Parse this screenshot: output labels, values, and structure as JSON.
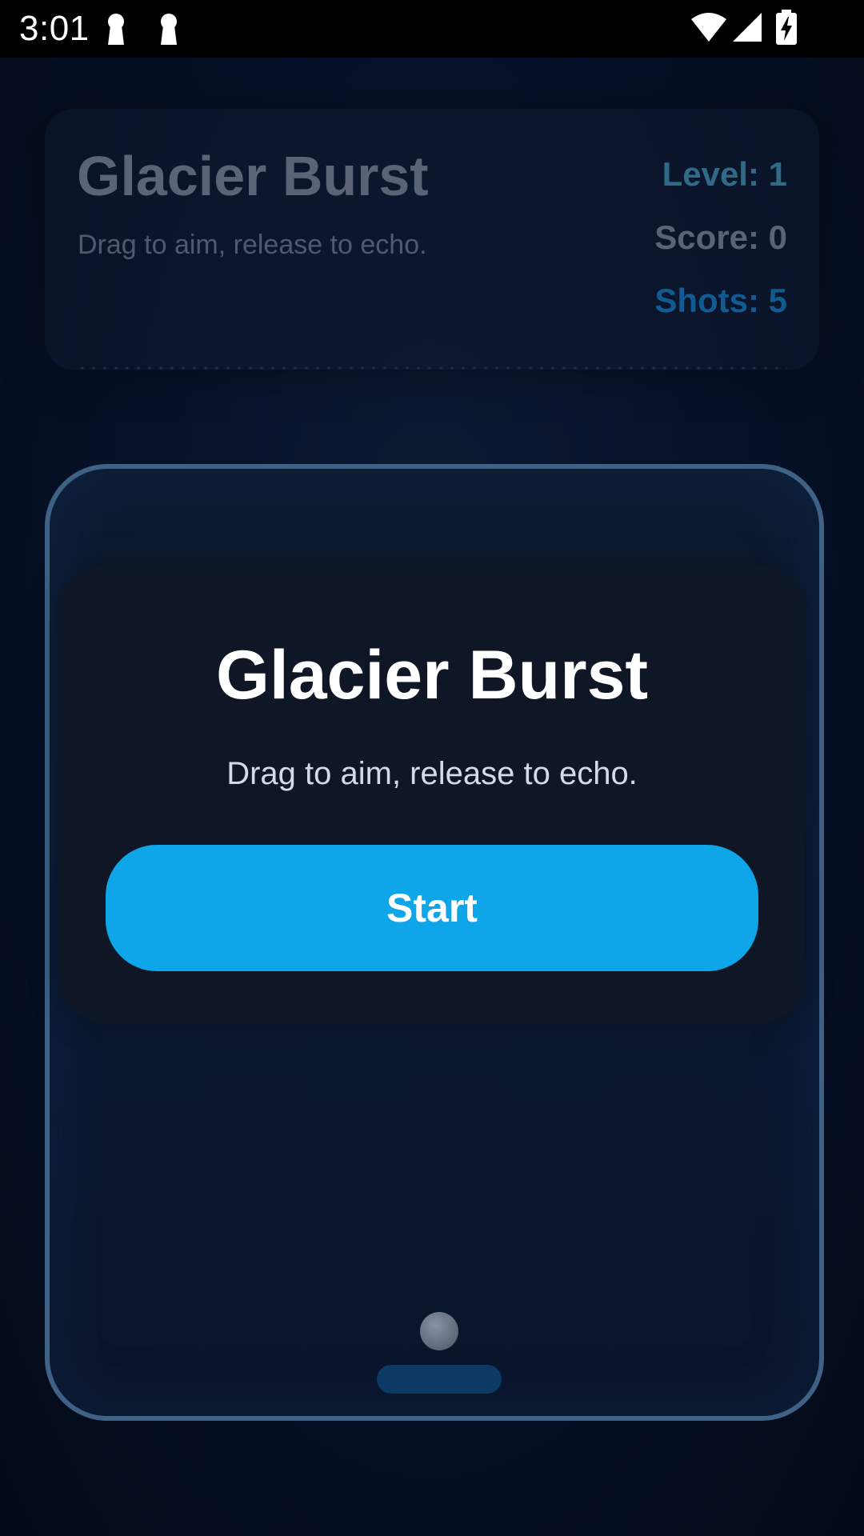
{
  "status_bar": {
    "time": "3:01",
    "icons": [
      "keyhole-icon",
      "keyhole-icon",
      "wifi-icon",
      "signal-icon",
      "battery-charging-icon"
    ]
  },
  "header": {
    "title": "Glacier Burst",
    "subtitle": "Drag to aim, release to echo.",
    "level": "Level: 1",
    "score": "Score: 0",
    "shots": "Shots: 5"
  },
  "overlay": {
    "title": "Glacier Burst",
    "subtitle": "Drag to aim, release to echo.",
    "start_label": "Start"
  },
  "colors": {
    "accent": "#0fa5e9",
    "board_border": "#3f6185",
    "level_text": "#2f6b86",
    "shots_text": "#0f5b92"
  }
}
